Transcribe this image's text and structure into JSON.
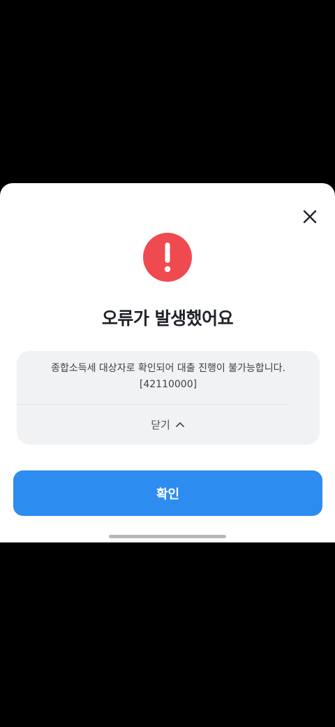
{
  "dialog": {
    "title": "오류가 발생했어요",
    "message_line1": "종합소득세 대상자로 확인되어 대출 진행이 불가능합니다.",
    "message_line2": "[42110000]",
    "collapse_label": "닫기",
    "confirm_label": "확인",
    "icons": {
      "close": "close-icon",
      "alert": "exclamation-circle-icon",
      "collapse": "chevron-up-icon"
    },
    "colors": {
      "alert": "#ef4a50",
      "primary": "#2d8cf0",
      "title_text": "#1f2329",
      "message_bg": "#f1f2f4"
    }
  }
}
